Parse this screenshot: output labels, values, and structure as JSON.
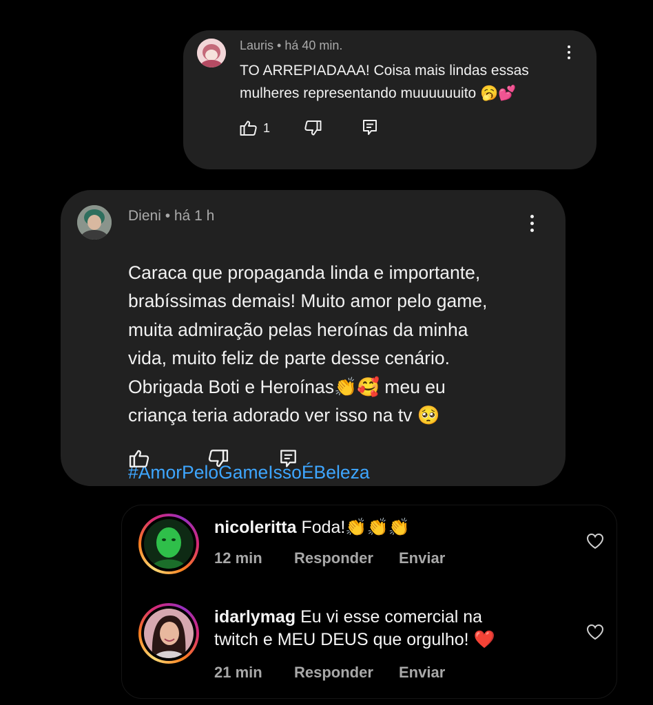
{
  "yt_comments": [
    {
      "author": "Lauris",
      "time": "há 40 min.",
      "meta": "Lauris • há 40 min.",
      "text": "TO ARREPIADAAA! Coisa mais lindas essas\nmulheres representando muuuuuuito 🥱💕",
      "likes": "1"
    },
    {
      "author": "Dieni",
      "time": "há 1 h",
      "meta": "Dieni • há 1 h",
      "text": "Caraca que propaganda linda e importante,\nbrabíssimas demais! Muito amor pelo game,\nmuita admiração pelas heroínas da minha\nvida, muito feliz de parte desse cenário.\nObrigada Boti e Heroínas👏🥰 meu eu\ncriança teria adorado ver isso na tv 🥺",
      "hashtag": "#AmorPeloGameIssoÉBeleza",
      "likes": ""
    }
  ],
  "ig_replies": [
    {
      "username": "nicoleritta",
      "text": "Foda!👏👏👏",
      "time": "12 min",
      "reply_label": "Responder",
      "send_label": "Enviar"
    },
    {
      "username": "idarlymag",
      "text": "Eu vi esse comercial na",
      "text_line2": "twitch e MEU DEUS que orgulho! ❤️",
      "time": "21 min",
      "reply_label": "Responder",
      "send_label": "Enviar"
    }
  ],
  "colors": {
    "yt_card_bg": "#212121",
    "meta_gray": "#aaaaaa",
    "hashtag_blue": "#3ea6ff",
    "ig_secondary": "#a8a8a8"
  },
  "icons": [
    "thumbs-up-icon",
    "thumbs-down-icon",
    "reply-icon",
    "more-vert-icon",
    "heart-icon"
  ]
}
